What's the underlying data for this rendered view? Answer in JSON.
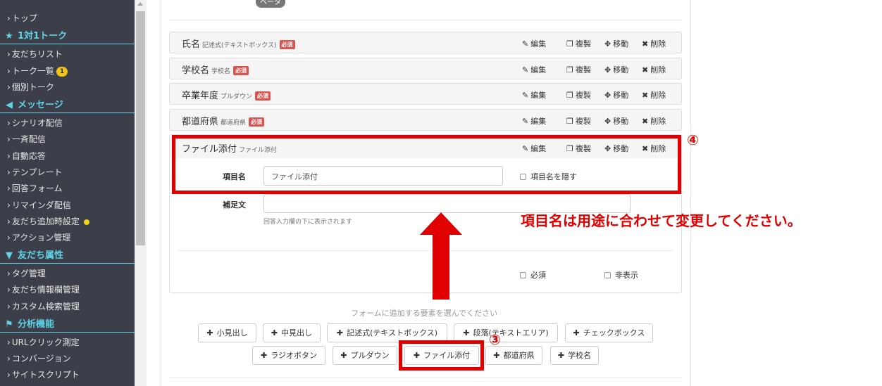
{
  "sidebar": {
    "items": [
      {
        "label": "トップ"
      },
      {
        "label": "友だちリスト"
      },
      {
        "label": "トーク一覧",
        "badge": "1"
      },
      {
        "label": "個別トーク"
      },
      {
        "label": "シナリオ配信"
      },
      {
        "label": "一斉配信"
      },
      {
        "label": "自動応答"
      },
      {
        "label": "テンプレート"
      },
      {
        "label": "回答フォーム"
      },
      {
        "label": "リマインダ配信"
      },
      {
        "label": "友だち追加時設定"
      },
      {
        "label": "アクション管理"
      },
      {
        "label": "タグ管理"
      },
      {
        "label": "友だち情報欄管理"
      },
      {
        "label": "カスタム検索管理"
      },
      {
        "label": "URLクリック測定"
      },
      {
        "label": "コンバージョン"
      },
      {
        "label": "サイトスクリプト"
      }
    ],
    "sections": [
      {
        "label": "1対1トーク",
        "icon": "star-icon"
      },
      {
        "label": "メッセージ",
        "icon": "megaphone-icon"
      },
      {
        "label": "友だち属性",
        "icon": "filter-icon"
      },
      {
        "label": "分析機能",
        "icon": "flag-icon"
      }
    ]
  },
  "main": {
    "beta_label": "ベータ",
    "rows": [
      {
        "name": "氏名",
        "type": "記述式(テキストボックス)",
        "required": "必須"
      },
      {
        "name": "学校名",
        "type": "学校名",
        "required": "必須"
      },
      {
        "name": "卒業年度",
        "type": "プルダウン",
        "required": "必須"
      },
      {
        "name": "都道府県",
        "type": "都道府県",
        "required": "必須"
      }
    ],
    "actions": {
      "edit": "編集",
      "copy": "複製",
      "move": "移動",
      "delete": "削除"
    },
    "expanded": {
      "name": "ファイル添付",
      "type": "ファイル添付",
      "field_label": "項目名",
      "field_value": "ファイル添付",
      "hide_label": "項目名を隠す",
      "note_label": "補足文",
      "note_value": "",
      "note_help": "回答入力欄の下に表示されます",
      "required_label": "必須",
      "hidden_label": "非表示"
    },
    "add_hint": "フォームに追加する要素を選んでください",
    "add_buttons_row1": [
      "小見出し",
      "中見出し",
      "記述式(テキストボックス)",
      "段落(テキストエリア)",
      "チェックボックス"
    ],
    "add_buttons_row2": [
      "ラジオボタン",
      "プルダウン",
      "ファイル添付",
      "都道府県",
      "学校名"
    ]
  },
  "annotations": {
    "num3": "③",
    "num4": "④",
    "note": "項目名は用途に合わせて変更してください。",
    "color": "#e00000"
  }
}
